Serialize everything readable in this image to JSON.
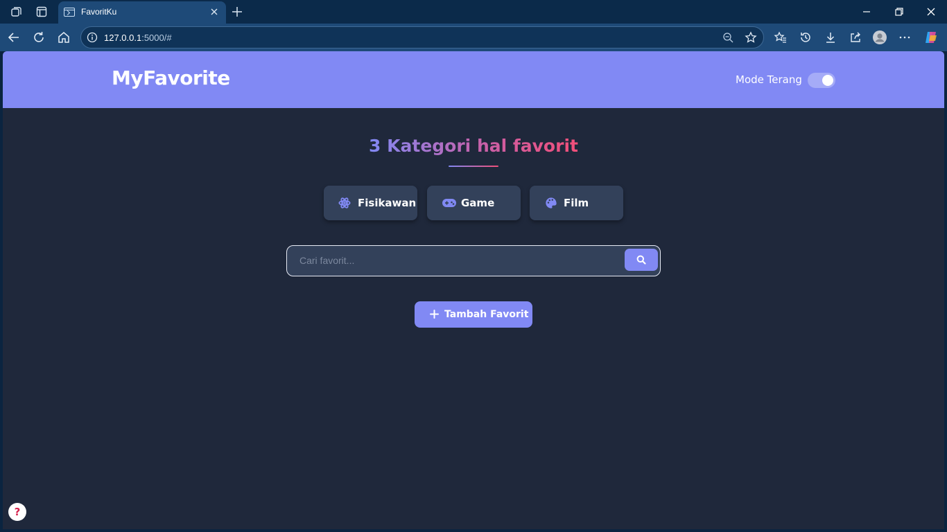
{
  "browser": {
    "tab_title": "FavoritKu",
    "url_host": "127.0.0.1",
    "url_rest": ":5000/#"
  },
  "header": {
    "logo": "MyFavorite",
    "mode_label": "Mode Terang",
    "mode_toggle_on": true
  },
  "main": {
    "heading": "3 Kategori hal favorit",
    "categories": [
      {
        "label": "Fisikawan",
        "icon": "atom-icon"
      },
      {
        "label": "Game",
        "icon": "gamepad-icon"
      },
      {
        "label": "Film",
        "icon": "palette-icon"
      }
    ],
    "search": {
      "placeholder": "Cari favorit...",
      "value": ""
    },
    "add_button": "Tambah Favorit"
  },
  "help_icon": "?",
  "colors": {
    "accent": "#8189f4",
    "background": "#1f283b",
    "card": "#33415a",
    "gradient_end": "#f24f79"
  }
}
